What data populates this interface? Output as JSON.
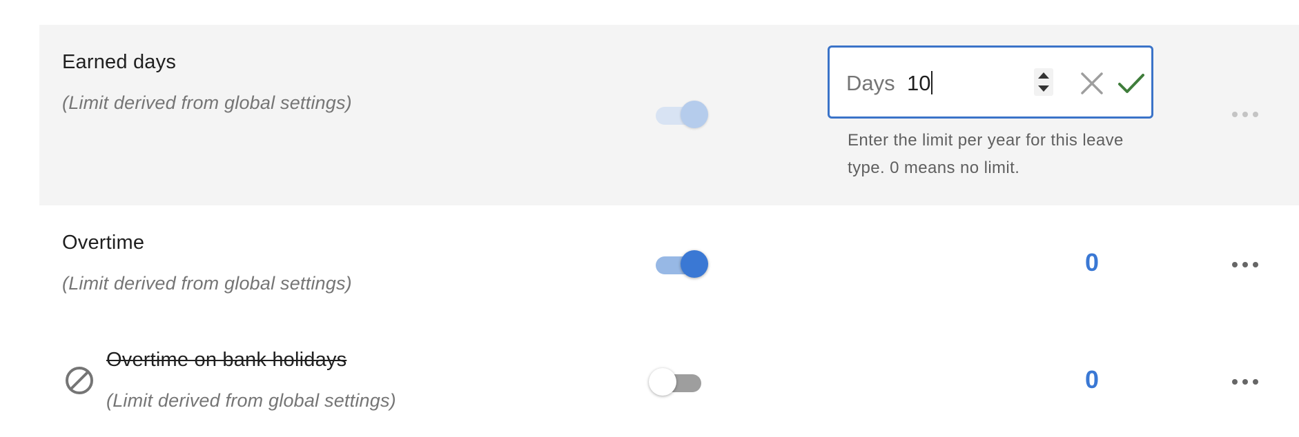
{
  "rows": [
    {
      "title": "Earned days",
      "subtitle": "(Limit derived from global settings)",
      "toggle_state": "on-disabled",
      "editor": {
        "prefix": "Days",
        "value": "10",
        "helper_text": "Enter the limit per year for this leave type. 0 means no limit.",
        "spinner_up_icon": "chevron-up-icon",
        "spinner_down_icon": "chevron-down-icon",
        "cancel_icon": "close-icon",
        "confirm_icon": "check-icon"
      },
      "more_icon": "more-horizontal-icon"
    },
    {
      "title": "Overtime",
      "subtitle": "(Limit derived from global settings)",
      "toggle_state": "on",
      "limit_value": "0",
      "more_icon": "more-horizontal-icon"
    },
    {
      "title": "Overtime on bank holidays",
      "subtitle": "(Limit derived from global settings)",
      "toggle_state": "off",
      "limit_value": "0",
      "status_icon": "blocked-icon",
      "title_struck_through": true,
      "more_icon": "more-horizontal-icon"
    }
  ],
  "colors": {
    "accent": "#3a78d4",
    "editor_border": "#3a73c8",
    "confirm": "#3f7d3b",
    "cancel": "#9e9e9e",
    "row_highlight": "#f4f4f4"
  }
}
